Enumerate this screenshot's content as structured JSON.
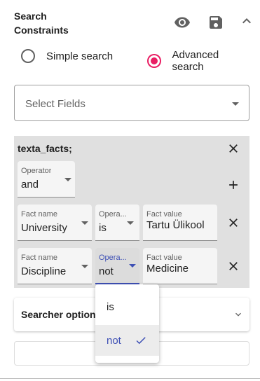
{
  "header": {
    "title_line1": "Search",
    "title_line2": "Constraints",
    "icons": [
      "eye-icon",
      "save-icon",
      "chevron-up-icon"
    ]
  },
  "search_mode": {
    "simple_label": "Simple search",
    "advanced_label": "Advanced search",
    "selected": "advanced"
  },
  "select_fields": {
    "placeholder": "Select Fields"
  },
  "facts": {
    "title": "texta_facts;",
    "operator_label": "Operator",
    "operator_value": "and",
    "rows": [
      {
        "fact_name_label": "Fact name",
        "fact_name": "University",
        "op_label": "Opera...",
        "op": "is",
        "fact_value_label": "Fact value",
        "fact_value": "Tartu Ülikool"
      },
      {
        "fact_name_label": "Fact name",
        "fact_name": "Discipline",
        "op_label": "Opera...",
        "op": "not",
        "fact_value_label": "Fact value",
        "fact_value": "Medicine"
      }
    ]
  },
  "searcher_options": {
    "title": "Searcher options"
  },
  "dropdown": {
    "options": [
      "is",
      "not"
    ],
    "selected": "not"
  },
  "colors": {
    "accent_pink": "#e91e63",
    "primary_indigo": "#3f51b5",
    "panel_gray": "#e0e0e0"
  }
}
